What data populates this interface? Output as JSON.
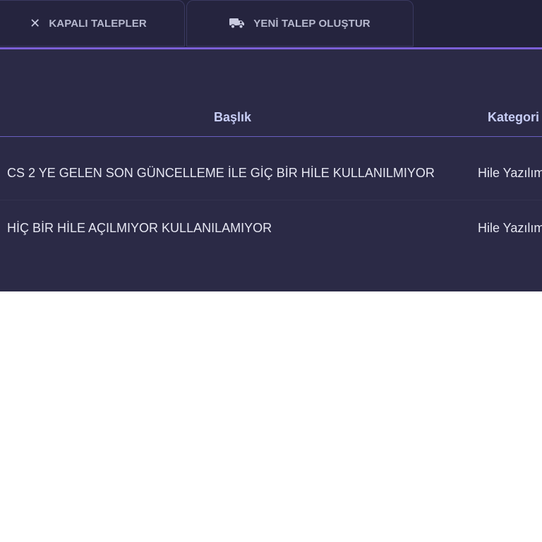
{
  "tabs": [
    {
      "label": "KAPALI TALEPLER",
      "icon": "close-icon"
    },
    {
      "label": "YENİ TALEP OLUŞTUR",
      "icon": "truck-icon"
    }
  ],
  "colors": {
    "panel_bg": "#2b2a46",
    "tabbar_bg": "#22223a",
    "accent": "#7b5fd6",
    "header_text": "#c7cdf5"
  },
  "table": {
    "columns": [
      "Başlık",
      "Kategori"
    ],
    "rows": [
      {
        "title": "CS 2 YE GELEN SON GÜNCELLEME İLE GİÇ BİR HİLE KULLANILMIYOR",
        "category": "Hile Yazılım"
      },
      {
        "title": "HİÇ BİR HİLE AÇILMIYOR KULLANILAMIYOR",
        "category": "Hile Yazılım"
      }
    ]
  }
}
